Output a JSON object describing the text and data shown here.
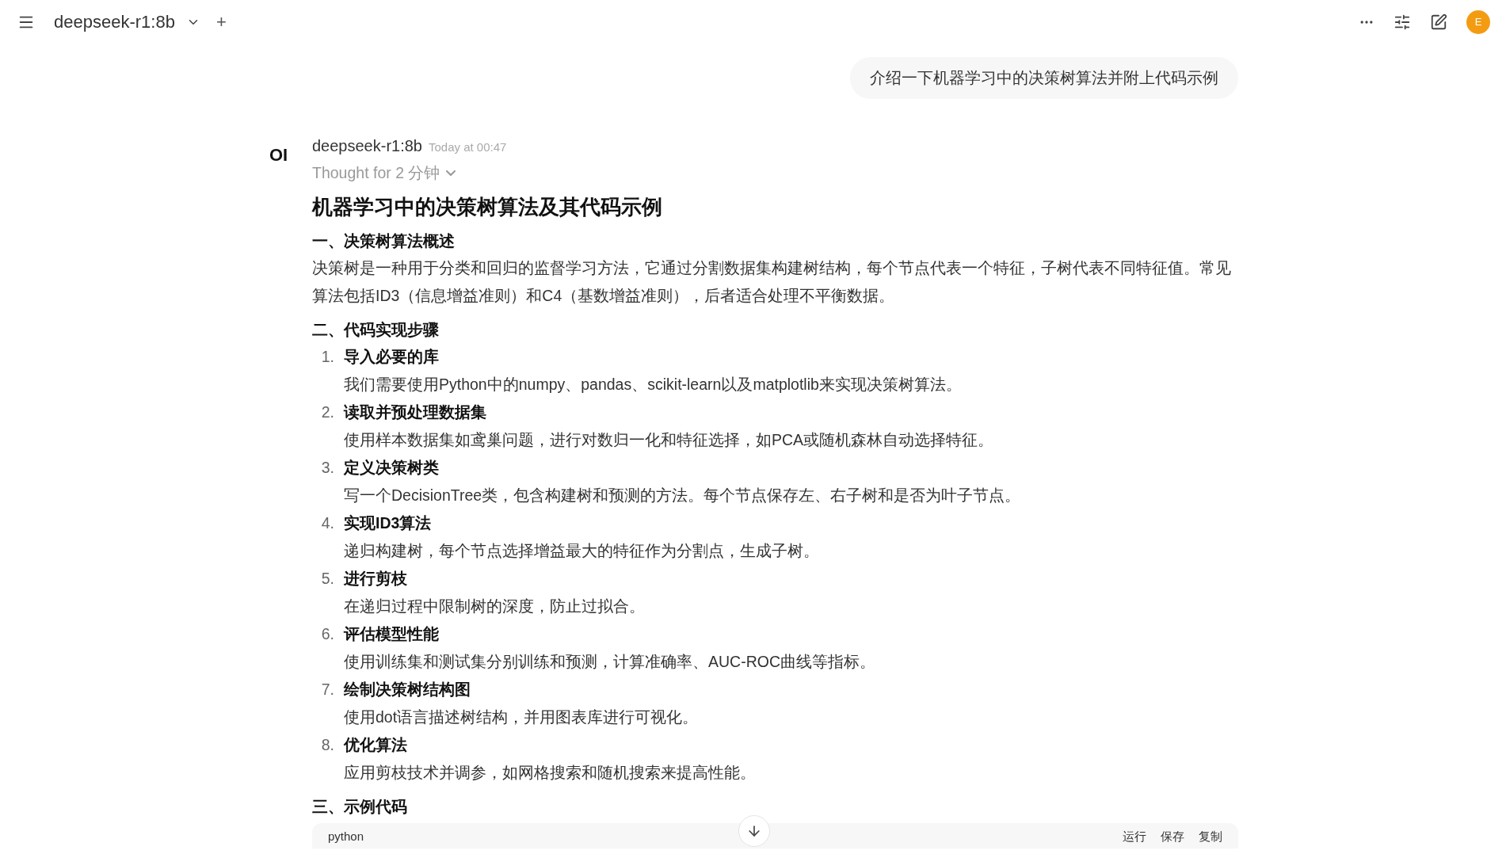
{
  "header": {
    "model": "deepseek-r1:8b",
    "add": "+",
    "avatar": "E"
  },
  "user_message": "介绍一下机器学习中的决策树算法并附上代码示例",
  "assistant": {
    "logo": "OI",
    "name": "deepseek-r1:8b",
    "time": "Today at 00:47",
    "thought": "Thought for 2 分钟",
    "thought_expanded": false,
    "title": "机器学习中的决策树算法及其代码示例",
    "blocks": [
      {
        "kind": "heading",
        "text": "一、决策树算法概述"
      },
      {
        "kind": "paragraph",
        "text": "决策树是一种用于分类和回归的监督学习方法，它通过分割数据集构建树结构，每个节点代表一个特征，子树代表不同特征值。常见算法包括ID3（信息增益准则）和C4（基数增益准则），后者适合处理不平衡数据。"
      },
      {
        "kind": "heading",
        "text": "二、代码实现步骤"
      },
      {
        "kind": "list",
        "items": [
          {
            "number": "1.",
            "title": "导入必要的库",
            "text": "我们需要使用Python中的numpy、pandas、scikit-learn以及matplotlib来实现决策树算法。"
          },
          {
            "number": "2.",
            "title": "读取并预处理数据集",
            "text": "使用样本数据集如鸢巢问题，进行对数归一化和特征选择，如PCA或随机森林自动选择特征。"
          },
          {
            "number": "3.",
            "title": "定义决策树类",
            "text": "写一个DecisionTree类，包含构建树和预测的方法。每个节点保存左、右子树和是否为叶子节点。"
          },
          {
            "number": "4.",
            "title": "实现ID3算法",
            "text": "递归构建树，每个节点选择增益最大的特征作为分割点，生成子树。"
          },
          {
            "number": "5.",
            "title": "进行剪枝",
            "text": "在递归过程中限制树的深度，防止过拟合。"
          },
          {
            "number": "6.",
            "title": "评估模型性能",
            "text": "使用训练集和测试集分别训练和预测，计算准确率、AUC-ROC曲线等指标。"
          },
          {
            "number": "7.",
            "title": "绘制决策树结构图",
            "text": "使用dot语言描述树结构，并用图表库进行可视化。"
          },
          {
            "number": "8.",
            "title": "优化算法",
            "text": "应用剪枝技术并调参，如网格搜索和随机搜索来提高性能。"
          }
        ]
      },
      {
        "kind": "heading",
        "text": "三、示例代码"
      },
      {
        "kind": "code",
        "language": "python",
        "actions": [
          "运行",
          "保存",
          "复制"
        ]
      }
    ]
  }
}
